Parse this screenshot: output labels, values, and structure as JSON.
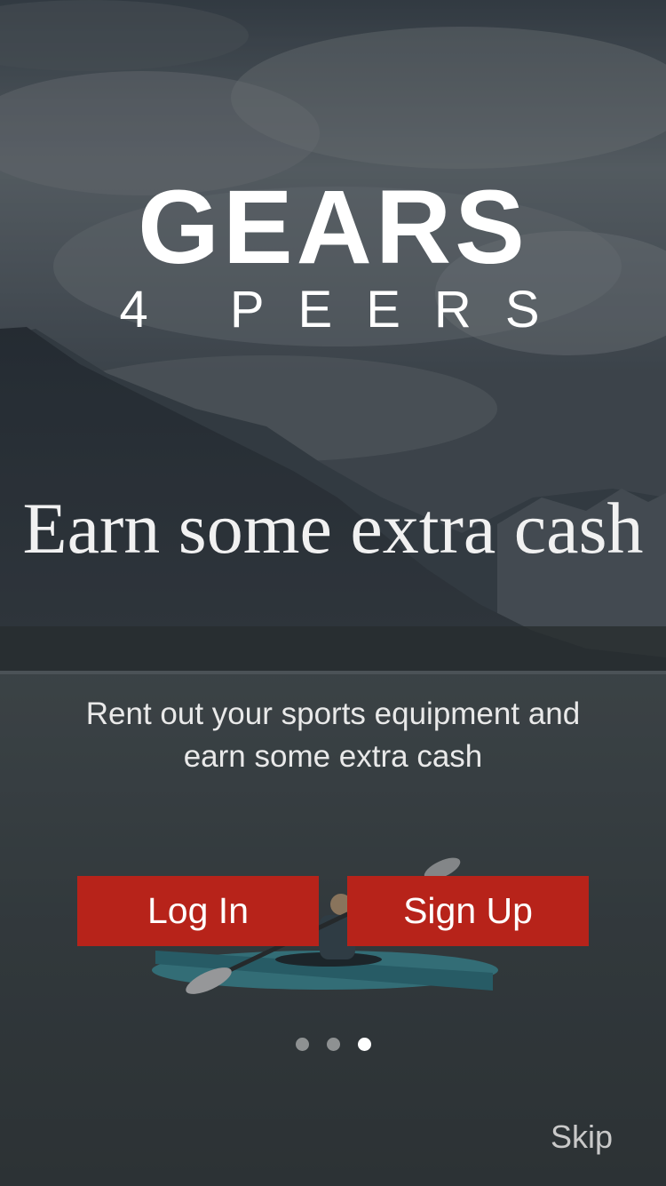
{
  "app": {
    "logo_main": "GEARS",
    "logo_sub": "4 PEERS"
  },
  "onboarding": {
    "headline": "Earn some extra cash",
    "description": "Rent out your sports equipment and earn some extra cash",
    "page_count": 3,
    "active_page": 3
  },
  "actions": {
    "login_label": "Log In",
    "signup_label": "Sign Up",
    "skip_label": "Skip"
  },
  "colors": {
    "button_bg": "#b7231a",
    "text": "#ffffff"
  },
  "background": {
    "scene": "mountain-lake-kayak-photo"
  }
}
